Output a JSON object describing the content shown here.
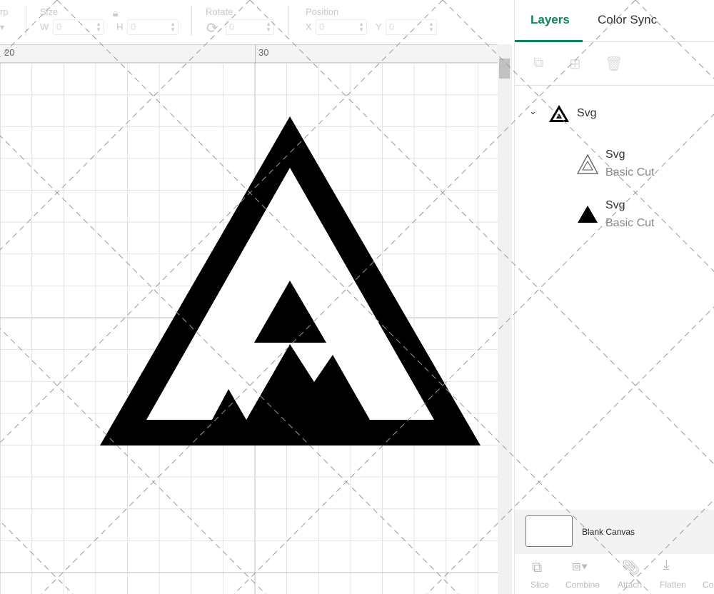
{
  "toolbar": {
    "warp_label": "rp",
    "size_label": "Size",
    "w_label": "W",
    "w_value": "0",
    "h_label": "H",
    "h_value": "0",
    "rotate_label": "Rotate",
    "rotate_value": "0",
    "position_label": "Position",
    "x_label": "X",
    "x_value": "0",
    "y_label": "Y",
    "y_value": "0"
  },
  "ruler": {
    "labels": [
      "20",
      "30"
    ]
  },
  "panel": {
    "tabs": [
      {
        "label": "Layers",
        "active": true
      },
      {
        "label": "Color Sync",
        "active": false
      }
    ],
    "group": {
      "name": "Svg"
    },
    "layers": [
      {
        "name": "Svg",
        "op": "Basic Cut",
        "icon": "outline-triangle-icon"
      },
      {
        "name": "Svg",
        "op": "Basic Cut",
        "icon": "solid-triangle-icon"
      }
    ],
    "canvas_label": "Blank Canvas",
    "actions": [
      "Slice",
      "Combine",
      "Attach",
      "Flatten",
      "Co"
    ]
  },
  "colors": {
    "accent": "#0b8461",
    "logo": "#000000"
  }
}
